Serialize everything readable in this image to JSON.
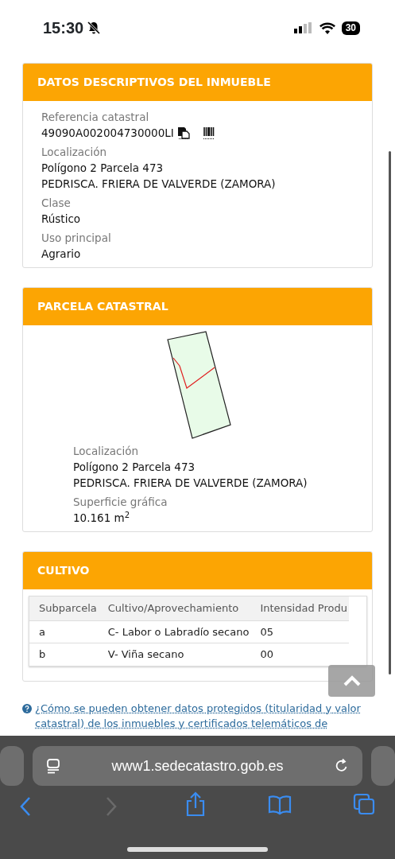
{
  "status_bar": {
    "time": "15:30",
    "battery": "30"
  },
  "cards": [
    {
      "title": "DATOS DESCRIPTIVOS DEL INMUEBLE",
      "fields": [
        {
          "label": "Referencia catastral",
          "lines": [
            "49090A002004730000LI"
          ],
          "kind": "reference"
        },
        {
          "label": "Localización",
          "lines": [
            "Polígono 2 Parcela 473",
            "PEDRISCA. FRIERA DE VALVERDE (ZAMORA)"
          ]
        },
        {
          "label": "Clase",
          "lines": [
            "Rústico"
          ]
        },
        {
          "label": "Uso principal",
          "lines": [
            "Agrario"
          ]
        }
      ]
    },
    {
      "title": "PARCELA CATASTRAL",
      "kind": "parcel",
      "fields": [
        {
          "label": "Localización",
          "lines": [
            "Polígono 2 Parcela 473",
            "PEDRISCA. FRIERA DE VALVERDE (ZAMORA)"
          ]
        },
        {
          "label": "Superficie gráfica",
          "lines": [
            "10.161 m$^{2}$"
          ]
        }
      ]
    },
    {
      "title": "CULTIVO",
      "kind": "table",
      "table": {
        "columns": [
          "Subparcela",
          "Cultivo/Aprovechamiento",
          "Intensidad Produ"
        ],
        "rows": [
          [
            "a",
            "C- Labor o Labradío secano",
            "05"
          ],
          [
            "b",
            "V- Viña secano",
            "00"
          ]
        ]
      }
    }
  ],
  "help_link": "¿Cómo se pueden obtener datos protegidos (titularidad y valor catastral) de los inmuebles y certificados telemáticos de",
  "browser": {
    "url": "www1.sedecatastro.gob.es"
  }
}
